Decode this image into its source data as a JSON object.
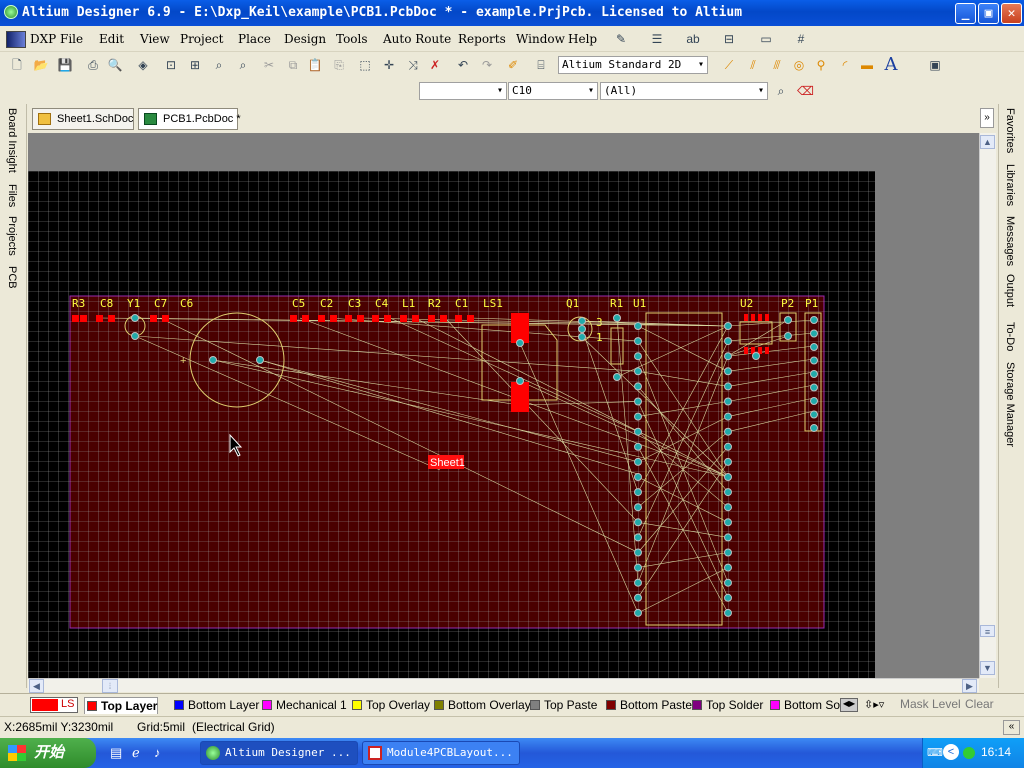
{
  "window": {
    "title": "Altium Designer 6.9 - E:\\Dxp_Keil\\example\\PCB1.PcbDoc * - example.PrjPcb. Licensed to Altium",
    "minimize": "_",
    "maximize": "▣",
    "close": "✕"
  },
  "menu": {
    "items": [
      "DXP",
      "File",
      "Edit",
      "View",
      "Project",
      "Place",
      "Design",
      "Tools",
      "Auto Route",
      "Reports",
      "Window",
      "Help"
    ]
  },
  "toolbar": {
    "view_mode": "Altium Standard 2D",
    "filter_empty": "",
    "component": "C10",
    "net": "(All)"
  },
  "left_panel": {
    "tabs": [
      "Board Insight",
      "Files",
      "Projects",
      "PCB"
    ]
  },
  "right_panel": {
    "tabs": [
      "Favorites",
      "Libraries",
      "Messages",
      "Output",
      "To-Do",
      "Storage Manager"
    ]
  },
  "doc_tabs": [
    {
      "label": "Sheet1.SchDoc",
      "active": false
    },
    {
      "label": "PCB1.PcbDoc *",
      "active": true
    }
  ],
  "pcb": {
    "room_label": "Sheet1",
    "designators": [
      "R3",
      "C8",
      "Y1",
      "C7",
      "C6",
      "C5",
      "C2",
      "C3",
      "C4",
      "L1",
      "R2",
      "C1",
      "LS1",
      "Q1",
      "R1",
      "U1",
      "U2",
      "P2",
      "P1"
    ],
    "pin_labels": [
      "3",
      "1"
    ]
  },
  "layers": {
    "current_label": "LS",
    "tabs": [
      {
        "label": "Top Layer",
        "color": "#ff0000",
        "active": true
      },
      {
        "label": "Bottom Layer",
        "color": "#0000ff",
        "active": false
      },
      {
        "label": "Mechanical 1",
        "color": "#ff00ff",
        "active": false
      },
      {
        "label": "Top Overlay",
        "color": "#ffff00",
        "active": false
      },
      {
        "label": "Bottom Overlay",
        "color": "#808000",
        "active": false
      },
      {
        "label": "Top Paste",
        "color": "#808080",
        "active": false
      },
      {
        "label": "Bottom Paste",
        "color": "#800000",
        "active": false
      },
      {
        "label": "Top Solder",
        "color": "#800080",
        "active": false
      },
      {
        "label": "Bottom Sol",
        "color": "#ff00ff",
        "active": false
      }
    ],
    "mask_level": "Mask Level",
    "clear": "Clear"
  },
  "status": {
    "coords": "X:2685mil Y:3230mil",
    "grid": "Grid:5mil",
    "mode": "(Electrical Grid)"
  },
  "taskbar": {
    "start": "开始",
    "tasks": [
      {
        "label": "Altium Designer ...",
        "active": true
      },
      {
        "label": "Module4PCBLayout...",
        "active": false
      }
    ],
    "clock": "16:14"
  }
}
